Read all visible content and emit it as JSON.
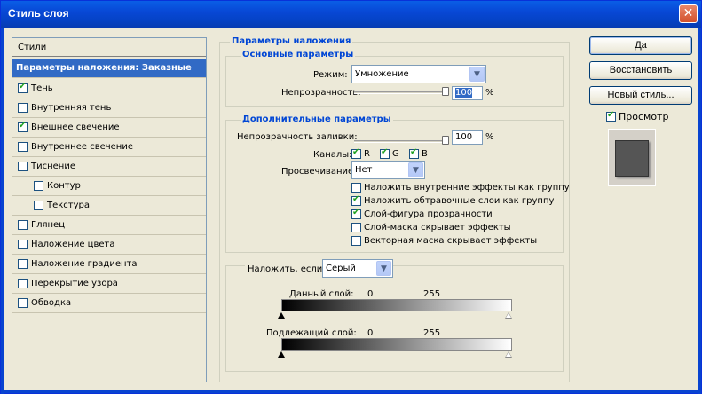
{
  "window": {
    "title": "Стиль слоя",
    "close_glyph": "✕"
  },
  "styles": {
    "header": "Стили",
    "selected": "Параметры наложения: Заказные",
    "items": [
      {
        "label": "Тень",
        "checked": true
      },
      {
        "label": "Внутренняя тень",
        "checked": false
      },
      {
        "label": "Внешнее свечение",
        "checked": true
      },
      {
        "label": "Внутреннее свечение",
        "checked": false
      },
      {
        "label": "Тиснение",
        "checked": false
      },
      {
        "label": "Контур",
        "checked": false
      },
      {
        "label": "Текстура",
        "checked": false
      },
      {
        "label": "Глянец",
        "checked": false
      },
      {
        "label": "Наложение цвета",
        "checked": false
      },
      {
        "label": "Наложение градиента",
        "checked": false
      },
      {
        "label": "Перекрытие узора",
        "checked": false
      },
      {
        "label": "Обводка",
        "checked": false
      }
    ]
  },
  "blending": {
    "section_title": "Параметры наложения",
    "basic": {
      "title": "Основные параметры",
      "mode_label": "Режим:",
      "mode_value": "Умножение",
      "opacity_label": "Непрозрачность:",
      "opacity_value": "100",
      "opacity_unit": "%",
      "opacity_fraction": 1.0
    },
    "advanced": {
      "title": "Дополнительные параметры",
      "fill_opacity_label": "Непрозрачность заливки:",
      "fill_opacity_value": "100",
      "fill_opacity_unit": "%",
      "fill_opacity_fraction": 1.0,
      "channels_label": "Каналы:",
      "channels": [
        {
          "label": "R",
          "checked": true
        },
        {
          "label": "G",
          "checked": true
        },
        {
          "label": "B",
          "checked": true
        }
      ],
      "knockout_label": "Просвечивание:",
      "knockout_value": "Нет",
      "options": [
        {
          "label": "Наложить внутренние эффекты как группу",
          "checked": false
        },
        {
          "label": "Наложить обтравочные слои как группу",
          "checked": true
        },
        {
          "label": "Слой-фигура прозрачности",
          "checked": true
        },
        {
          "label": "Слой-маска скрывает эффекты",
          "checked": false
        },
        {
          "label": "Векторная маска скрывает эффекты",
          "checked": false
        }
      ]
    },
    "blend_if": {
      "label": "Наложить, если:",
      "value": "Серый",
      "this_layer_label": "Данный слой:",
      "this_layer_min": "0",
      "this_layer_max": "255",
      "underlying_label": "Подлежащий слой:",
      "underlying_min": "0",
      "underlying_max": "255"
    }
  },
  "buttons": {
    "ok": "Да",
    "reset": "Восстановить",
    "new_style": "Новый стиль...",
    "preview_label": "Просмотр",
    "preview_checked": true
  },
  "colors": {
    "titlebar": "#0a5ee6",
    "selection": "#316ac5",
    "section_title": "#0046d5",
    "check": "#21a121"
  },
  "icons": {
    "dropdown": "chevron-down-icon",
    "check": "check-icon",
    "close": "close-icon"
  }
}
